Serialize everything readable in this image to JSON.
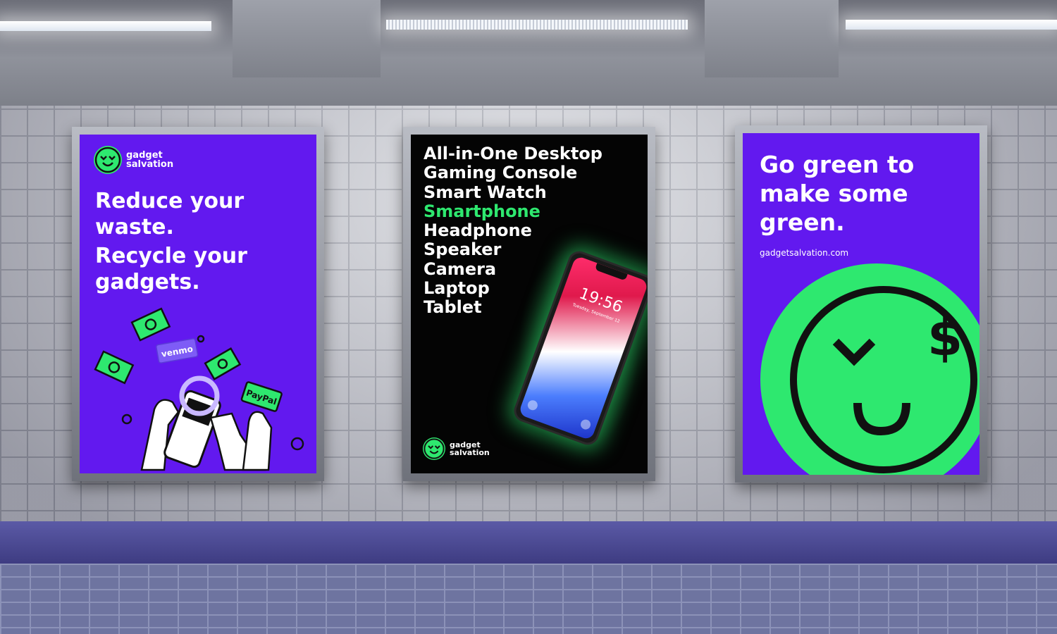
{
  "brand": {
    "name_line1": "gadget",
    "name_line2": "salvation",
    "accent": "#2ee86f",
    "purple": "#6219ef"
  },
  "poster_left": {
    "headline1_line1": "Reduce your",
    "headline1_line2": "waste.",
    "headline2_line1": "Recycle your",
    "headline2_line2": "gadgets.",
    "venmo_label": "venmo",
    "paypal_label": "PayPal"
  },
  "poster_middle": {
    "items": [
      "All-in-One Desktop",
      "Gaming Console",
      "Smart Watch",
      "Smartphone",
      "Headphone",
      "Speaker",
      "Camera",
      "Laptop",
      "Tablet"
    ],
    "highlighted_item": "Smartphone",
    "phone_time": "19:56",
    "phone_date": "Tuesday, September 12"
  },
  "poster_right": {
    "headline_line1": "Go green to",
    "headline_line2": "make some",
    "headline_line3": "green.",
    "url": "gadgetsalvation.com",
    "dollar_sign": "$"
  }
}
